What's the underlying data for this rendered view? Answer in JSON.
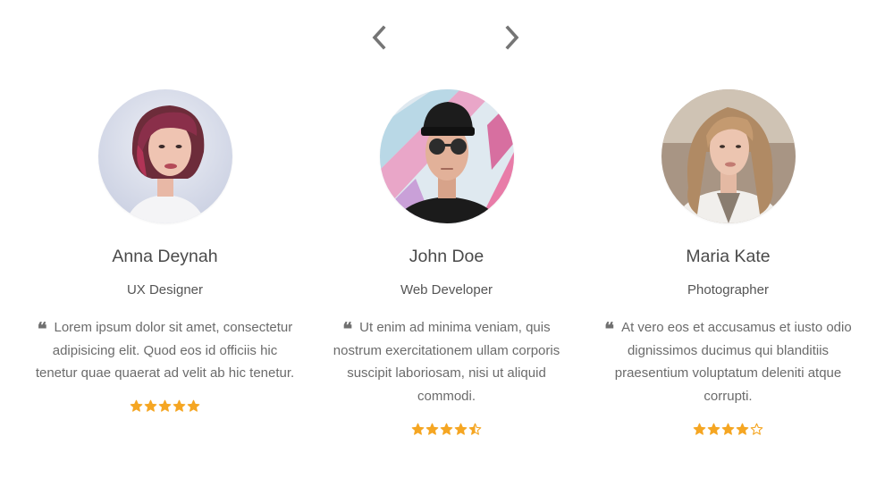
{
  "carousel": {
    "prev_icon": "chevron-left-icon",
    "next_icon": "chevron-right-icon",
    "arrow_color": "#757575"
  },
  "star_color": "#f5a623",
  "testimonials": [
    {
      "name": "Anna Deynah",
      "role": "UX Designer",
      "quote": "Lorem ipsum dolor sit amet, consectetur adipisicing elit. Quod eos id officiis hic tenetur quae quaerat ad velit ab hic tenetur.",
      "rating": 5,
      "avatar": "avatar-photo"
    },
    {
      "name": "John Doe",
      "role": "Web Developer",
      "quote": "Ut enim ad minima veniam, quis nostrum exercitationem ullam corporis suscipit laboriosam, nisi ut aliquid commodi.",
      "rating": 4.5,
      "avatar": "avatar-photo"
    },
    {
      "name": "Maria Kate",
      "role": "Photographer",
      "quote": "At vero eos et accusamus et iusto odio dignissimos ducimus qui blanditiis praesentium voluptatum deleniti atque corrupti.",
      "rating": 4,
      "avatar": "avatar-photo"
    }
  ]
}
